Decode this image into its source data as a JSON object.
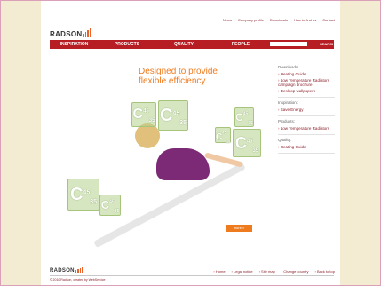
{
  "top_nav": [
    "News",
    "Company profile",
    "Downloads",
    "How to find us",
    "Contact"
  ],
  "logo": {
    "text": "RADSON"
  },
  "main_nav": [
    "INSPIRATION",
    "PRODUCTS",
    "QUALITY",
    "PEOPLE"
  ],
  "search": {
    "button_label": "SEARCH",
    "placeholder": ""
  },
  "hero": {
    "headline_line1": "Designed to provide",
    "headline_line2": "flexible efficiency.",
    "more_button": "more >",
    "badges": [
      {
        "big": "C",
        "top": "45",
        "bottom": "35"
      },
      {
        "big": "C",
        "top": "45",
        "bottom": "35"
      },
      {
        "big": "C",
        "top": "45",
        "bottom": "35"
      },
      {
        "big": "C",
        "top": "45",
        "bottom": "35"
      },
      {
        "big": "C",
        "top": "45",
        "bottom": "35"
      },
      {
        "big": "C",
        "top": "45",
        "bottom": "35"
      },
      {
        "big": "C",
        "top": "45",
        "bottom": "35"
      }
    ]
  },
  "sidebar": {
    "downloads_heading": "Downloads:",
    "downloads": [
      "Heating Guide",
      "Low Temperature Radiators campaign brochure",
      "Desktop wallpapers"
    ],
    "inspiration_heading": "Inspiration:",
    "inspiration": [
      "Save Energy"
    ],
    "products_heading": "Products:",
    "products": [
      "Low Temperature Radiators"
    ],
    "quality_heading": "Quality:",
    "quality": [
      "Heating Guide"
    ]
  },
  "footer": {
    "links": [
      "Home",
      "Legal notice",
      "Site map",
      "Change country",
      "Back to top"
    ],
    "copyright": "© 2010 Radson, created by WebService"
  },
  "colors": {
    "brand_red": "#b71e24",
    "accent_orange": "#ef7b1f",
    "background_beige": "#f3ecd3"
  }
}
